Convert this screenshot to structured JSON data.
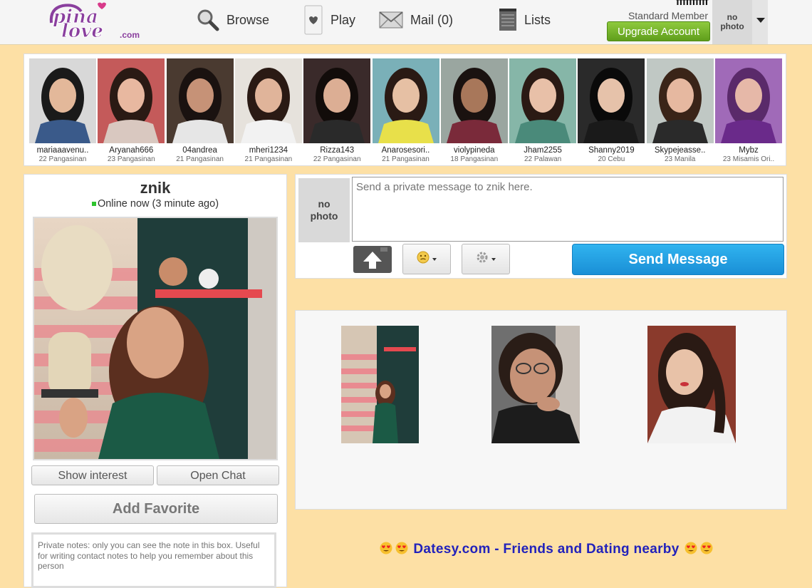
{
  "header": {
    "logo_text": "pina love",
    "logo_suffix": ".com",
    "nav": {
      "browse": "Browse",
      "play": "Play",
      "mail": "Mail (0)",
      "lists": "Lists"
    },
    "user": {
      "username": "ffffffffff",
      "level": "Standard Member",
      "upgrade": "Upgrade Account",
      "avatar_text_1": "no",
      "avatar_text_2": "photo"
    }
  },
  "members": [
    {
      "name": "mariaaavenu..",
      "info": "22 Pangasinan"
    },
    {
      "name": "Aryanah666",
      "info": "23 Pangasinan"
    },
    {
      "name": "04andrea",
      "info": "21 Pangasinan"
    },
    {
      "name": "mheri1234",
      "info": "21 Pangasinan"
    },
    {
      "name": "Rizza143",
      "info": "22 Pangasinan"
    },
    {
      "name": "Anarosesori..",
      "info": "21 Pangasinan"
    },
    {
      "name": "violypineda",
      "info": "18 Pangasinan"
    },
    {
      "name": "Jham2255",
      "info": "22 Palawan"
    },
    {
      "name": "Shanny2019",
      "info": "20 Cebu"
    },
    {
      "name": "Skypejeasse..",
      "info": "23 Manila"
    },
    {
      "name": "Mybz",
      "info": "23 Misamis Ori.."
    }
  ],
  "profile": {
    "name": "znik",
    "status": "Online now (3 minute ago)",
    "show_interest": "Show interest",
    "open_chat": "Open Chat",
    "add_favorite": "Add Favorite",
    "notes_placeholder": "Private notes: only you can see the note in this box. Useful for writing contact notes to help you remember about this person"
  },
  "message": {
    "avatar_text_1": "no",
    "avatar_text_2": "photo",
    "placeholder": "Send a private message to znik here.",
    "send": "Send Message"
  },
  "promo": {
    "text": "Datesy.com - Friends and Dating nearby"
  },
  "colors": {
    "page_bg": "#fde0a5",
    "upgrade_green": "#6aad25",
    "send_blue": "#1fa0e3",
    "promo_blue": "#2222bb",
    "online_green": "#2ec42e",
    "logo_purple": "#8a3f9e"
  }
}
